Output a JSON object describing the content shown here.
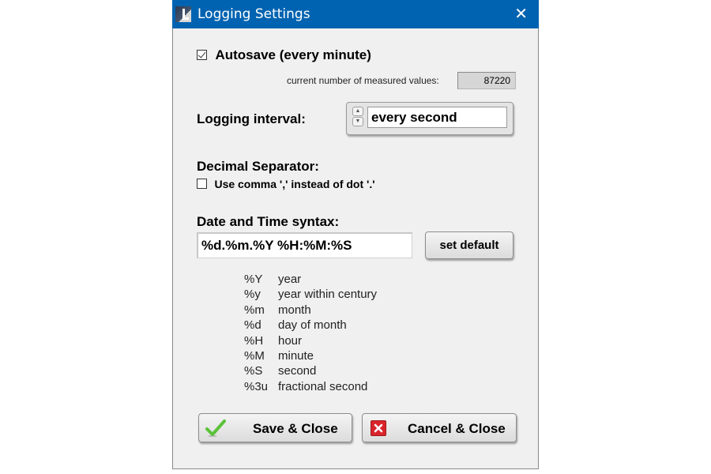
{
  "window": {
    "title": "Logging Settings",
    "close_glyph": "✕"
  },
  "autosave": {
    "label": "Autosave (every minute)",
    "checked": true
  },
  "measured_values": {
    "label": "current number of measured values:",
    "value": "87220"
  },
  "logging_interval": {
    "label": "Logging interval:",
    "value": "every second",
    "up_glyph": "▲",
    "down_glyph": "▼"
  },
  "decimal_separator": {
    "heading": "Decimal Separator:",
    "option_label": "Use comma ',' instead of dot '.'",
    "checked": false
  },
  "date_time": {
    "heading": "Date and Time syntax:",
    "value": "%d.%m.%Y %H:%M:%S",
    "set_default_label": "set default"
  },
  "legend": [
    {
      "code": "%Y",
      "desc": "year"
    },
    {
      "code": "%y",
      "desc": "year within century"
    },
    {
      "code": "%m",
      "desc": "month"
    },
    {
      "code": "%d",
      "desc": "day of month"
    },
    {
      "code": "%H",
      "desc": "hour"
    },
    {
      "code": "%M",
      "desc": "minute"
    },
    {
      "code": "%S",
      "desc": "second"
    },
    {
      "code": "%3u",
      "desc": "fractional second"
    }
  ],
  "buttons": {
    "save_label": "Save & Close",
    "cancel_label": "Cancel & Close"
  },
  "colors": {
    "titlebar": "#0063b1",
    "save_icon": "#5cc23a",
    "cancel_icon": "#d9242b"
  }
}
